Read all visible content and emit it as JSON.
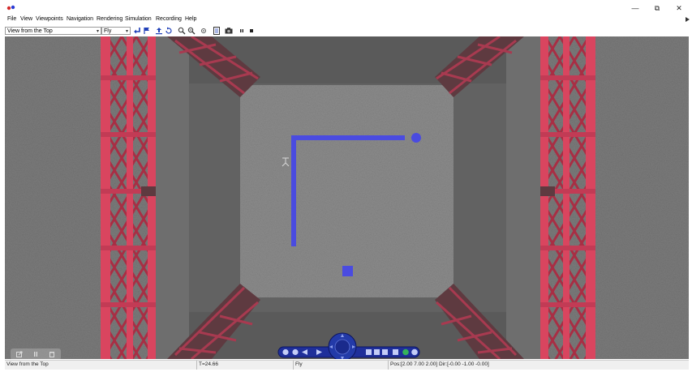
{
  "window": {
    "minimize_glyph": "—",
    "maximize_glyph": "⧉",
    "close_glyph": "✕"
  },
  "menu": [
    "File",
    "View",
    "Viewpoints",
    "Navigation",
    "Rendering",
    "Simulation",
    "Recording",
    "Help"
  ],
  "toolbar": {
    "viewpoint_value": "View from the Top",
    "navigation_mode_value": "Fly"
  },
  "status": {
    "viewpoint": "View from the Top",
    "time": "T=24.66",
    "mode": "Fly",
    "position": "Pos:[2.00 7.00 2.00] Dir:[-0.00 -1.00 -0.00]"
  },
  "colors": {
    "ground": "#6d6d6d",
    "inner_floor": "#8a8a8a",
    "scaffold_red": "#d9455f",
    "marker_blue": "#4a4be0",
    "controller_navy": "#1f2f9a"
  }
}
